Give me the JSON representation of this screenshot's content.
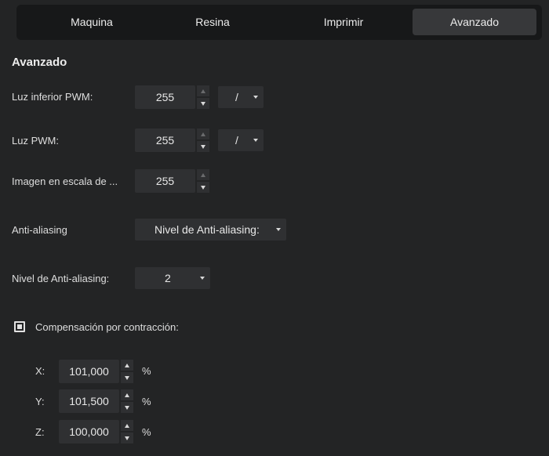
{
  "tabs": [
    {
      "label": "Maquina",
      "active": false
    },
    {
      "label": "Resina",
      "active": false
    },
    {
      "label": "Imprimir",
      "active": false
    },
    {
      "label": "Avanzado",
      "active": true
    }
  ],
  "section_title": "Avanzado",
  "fields": {
    "bottom_pwm": {
      "label": "Luz inferior PWM:",
      "value": "255",
      "unit_select": "/"
    },
    "pwm": {
      "label": "Luz PWM:",
      "value": "255",
      "unit_select": "/"
    },
    "grayscale": {
      "label": "Imagen en escala de ...",
      "value": "255"
    },
    "anti_aliasing": {
      "label": "Anti-aliasing",
      "select": "Nivel de Anti-aliasing:"
    },
    "aa_level": {
      "label": "Nivel de Anti-aliasing:",
      "select": "2"
    }
  },
  "shrink": {
    "checkbox_label": "Compensación por contracción:",
    "checked": true,
    "x": {
      "label": "X:",
      "value": "101,000",
      "unit": "%"
    },
    "y": {
      "label": "Y:",
      "value": "101,500",
      "unit": "%"
    },
    "z": {
      "label": "Z:",
      "value": "100,000",
      "unit": "%"
    }
  },
  "icons": [
    "spin-up-icon",
    "spin-down-icon",
    "chevron-down-icon",
    "checkbox-checked-icon"
  ],
  "colors": {
    "background": "#232425",
    "tabbar": "#171819",
    "active_tab": "#37383a",
    "input": "#2f3032",
    "text": "#e4e4e4"
  }
}
